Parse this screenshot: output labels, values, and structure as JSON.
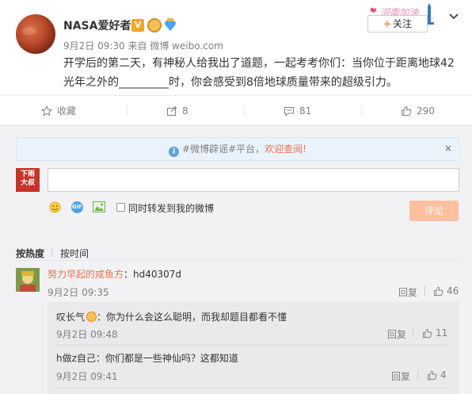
{
  "post": {
    "username": "NASA爱好者",
    "badge_v": "V",
    "date": "9月2日 09:30",
    "via_prefix": "来自",
    "source": "微博 weibo.com",
    "text": "开学后的第二天，有神秘人给我出了道题，一起考考你们：当你位于距离地球42光年之外的_________时，你会感受到8倍地球质量带来的超级引力。",
    "follow_label": "关注",
    "follow_plus": "+"
  },
  "actions": {
    "favorite_label": "收藏",
    "repost_count": "8",
    "comment_count": "81",
    "like_count": "290"
  },
  "notice": {
    "info": "i",
    "prefix": "#微博辟谣#平台，",
    "highlight": "欢迎查阅!",
    "close": "×"
  },
  "composer": {
    "avatar_line1": "下雨",
    "avatar_line2": "大叔",
    "input_value": "",
    "emoji_icon": "emoji-icon",
    "gif_label": "GIF",
    "image_icon": "image-icon",
    "repost_label": "同时转发到我的微博",
    "submit_label": "评论"
  },
  "sort": {
    "hot": "按热度",
    "time": "按时间"
  },
  "comments": [
    {
      "name": "努力早起的咸鱼方",
      "text": "：hd40307d",
      "time": "9月2日 09:35",
      "reply_label": "回复",
      "likes": "46"
    }
  ],
  "replies": [
    {
      "name": "叹长气",
      "text": "：你为什么会这么聪明，而我却题目都看不懂",
      "time": "9月2日 09:48",
      "reply_label": "回复",
      "likes": "11"
    },
    {
      "name": "h做z自己",
      "text": "：你们都是一些神仙吗？这都知道",
      "time": "9月2日 09:41",
      "reply_label": "回复",
      "likes": "4"
    }
  ],
  "colors": {
    "accent": "#eb7350",
    "button_disabled": "#ffc09f",
    "notice_bg": "#eaf3fb"
  }
}
